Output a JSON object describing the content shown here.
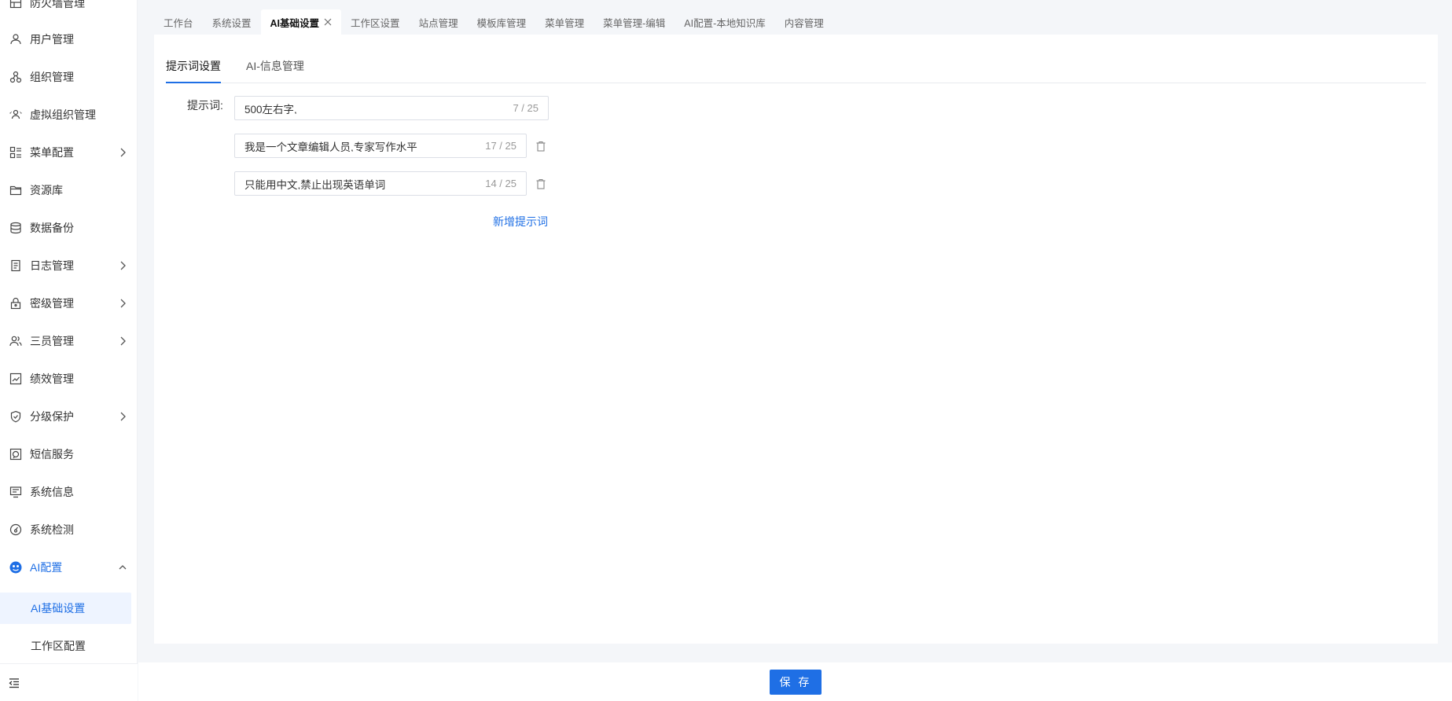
{
  "sidebar": {
    "items": [
      {
        "label": "防火墙管理",
        "icon": "table-icon"
      },
      {
        "label": "用户管理",
        "icon": "user-icon"
      },
      {
        "label": "组织管理",
        "icon": "org-icon"
      },
      {
        "label": "虚拟组织管理",
        "icon": "virtual-org-icon"
      },
      {
        "label": "菜单配置",
        "icon": "menu-config-icon"
      },
      {
        "label": "资源库",
        "icon": "folder-icon"
      },
      {
        "label": "数据备份",
        "icon": "database-icon"
      },
      {
        "label": "日志管理",
        "icon": "log-icon"
      },
      {
        "label": "密级管理",
        "icon": "lock-icon"
      },
      {
        "label": "三员管理",
        "icon": "users-icon"
      },
      {
        "label": "绩效管理",
        "icon": "performance-icon"
      },
      {
        "label": "分级保护",
        "icon": "shield-icon"
      },
      {
        "label": "短信服务",
        "icon": "sms-icon"
      },
      {
        "label": "系统信息",
        "icon": "monitor-icon"
      },
      {
        "label": "系统检测",
        "icon": "gauge-icon"
      },
      {
        "label": "AI配置",
        "icon": "ai-icon"
      }
    ],
    "sub_items": [
      {
        "label": "AI基础设置"
      },
      {
        "label": "工作区配置"
      }
    ]
  },
  "tabs": [
    {
      "label": "工作台"
    },
    {
      "label": "系统设置"
    },
    {
      "label": "AI基础设置"
    },
    {
      "label": "工作区设置"
    },
    {
      "label": "站点管理"
    },
    {
      "label": "模板库管理"
    },
    {
      "label": "菜单管理"
    },
    {
      "label": "菜单管理-编辑"
    },
    {
      "label": "AI配置-本地知识库"
    },
    {
      "label": "内容管理"
    }
  ],
  "subtabs": [
    {
      "label": "提示词设置"
    },
    {
      "label": "AI-信息管理"
    }
  ],
  "form": {
    "label": "提示词:",
    "prompts": [
      {
        "value": "500左右字,",
        "count": "7 / 25"
      },
      {
        "value": "我是一个文章编辑人员,专家写作水平",
        "count": "17 / 25"
      },
      {
        "value": "只能用中文,禁止出现英语单词",
        "count": "14 / 25"
      }
    ],
    "add_label": "新增提示词"
  },
  "footer": {
    "save_label": "保 存"
  },
  "colors": {
    "accent": "#1f6fe5",
    "background": "#f4f6f9"
  }
}
